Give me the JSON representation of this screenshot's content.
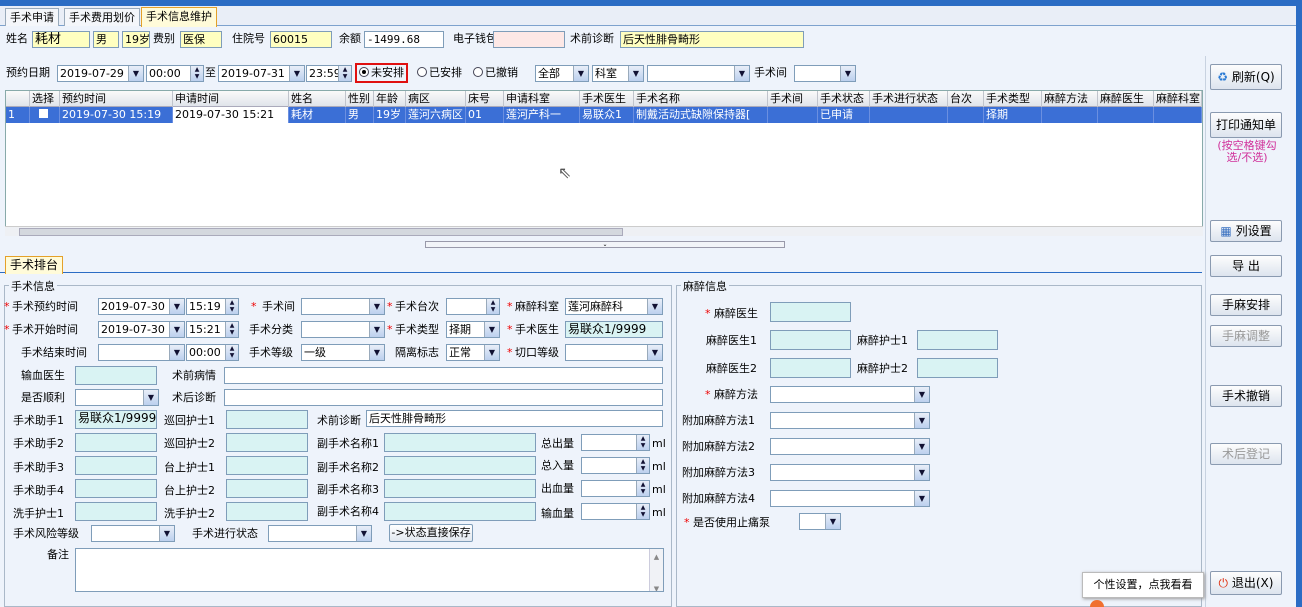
{
  "tabs": [
    "手术申请",
    "手术费用划价",
    "手术信息维护"
  ],
  "patient": {
    "name_label": "姓名",
    "name": "耗材",
    "sex": "男",
    "age": "19岁",
    "fee_label": "费别",
    "fee": "医保",
    "inpatient_label": "住院号",
    "inpatient": "60015",
    "balance_label": "余额",
    "balance": "-1499.68",
    "wallet_label": "电子钱包",
    "wallet": "",
    "diag_label": "术前诊断",
    "diag": "后天性腓骨畸形"
  },
  "filter": {
    "date_label": "预约日期",
    "from_date": "2019-07-29",
    "from_time": "00:00",
    "to_label": "至",
    "to_date": "2019-07-31",
    "to_time": "23:59",
    "r1": "未安排",
    "r2": "已安排",
    "r3": "已撤销",
    "scope": "全部",
    "dept": "科室",
    "dept_val": "",
    "room_label": "手术间",
    "room": ""
  },
  "grid": {
    "headers": [
      "选择",
      "预约时间",
      "申请时间",
      "姓名",
      "性别",
      "年龄",
      "病区",
      "床号",
      "申请科室",
      "手术医生",
      "手术名称",
      "手术间",
      "手术状态",
      "手术进行状态",
      "台次",
      "手术类型",
      "麻醉方法",
      "麻醉医生",
      "麻醉科室"
    ],
    "row": [
      "1",
      "",
      "2019-07-30 15:19",
      "2019-07-30 15:21",
      "耗材",
      "男",
      "19岁",
      "莲河六病区",
      "01",
      "莲河产科一",
      "易联众1",
      "制戴活动式缺隙保持器[",
      "",
      "已申请",
      "",
      "",
      "择期",
      "",
      "",
      ""
    ]
  },
  "section_tab": "手术排台",
  "surg": {
    "title": "手术信息",
    "appt_label": "手术预约时间",
    "appt_date": "2019-07-30",
    "appt_time": "15:19",
    "room_label": "手术间",
    "room": "",
    "table_label": "手术台次",
    "table": "",
    "anes_dept_label": "麻醉科室",
    "anes_dept": "莲河麻醉科",
    "start_label": "手术开始时间",
    "start_date": "2019-07-30",
    "start_time": "15:21",
    "class_label": "手术分类",
    "class": "",
    "type_label": "手术类型",
    "type": "择期",
    "doctor_label": "手术医生",
    "doctor": "易联众1/9999",
    "end_label": "手术结束时间",
    "end_date": "",
    "end_time": "00:00",
    "level_label": "手术等级",
    "level": "一级",
    "iso_label": "隔离标志",
    "iso": "正常",
    "incision_label": "切口等级",
    "incision": "",
    "blood_doc_label": "输血医生",
    "pre_cond_label": "术前病情",
    "smooth_label": "是否顺利",
    "post_diag_label": "术后诊断",
    "asst1_label": "手术助手1",
    "asst1": "易联众1/9999",
    "tour1_label": "巡回护士1",
    "pre_diag_label": "术前诊断",
    "pre_diag": "后天性腓骨畸形",
    "asst2_label": "手术助手2",
    "tour2_label": "巡回护士2",
    "sub1_label": "副手术名称1",
    "out_label": "总出量",
    "asst3_label": "手术助手3",
    "stage1_label": "台上护士1",
    "sub2_label": "副手术名称2",
    "in_label": "总入量",
    "asst4_label": "手术助手4",
    "stage2_label": "台上护士2",
    "sub3_label": "副手术名称3",
    "bleed_label": "出血量",
    "wash_label": "洗手护士1",
    "wash2_label": "洗手护士2",
    "sub4_label": "副手术名称4",
    "trans_label": "输血量",
    "ml": "ml",
    "risk_label": "手术风险等级",
    "status_label": "手术进行状态",
    "save_btn": "->状态直接保存",
    "remark_label": "备注"
  },
  "anes": {
    "title": "麻醉信息",
    "doc_label": "麻醉医生",
    "doc1_label": "麻醉医生1",
    "nurse1_label": "麻醉护士1",
    "doc2_label": "麻醉医生2",
    "nurse2_label": "麻醉护士2",
    "method_label": "麻醉方法",
    "add1": "附加麻醉方法1",
    "add2": "附加麻醉方法2",
    "add3": "附加麻醉方法3",
    "add4": "附加麻醉方法4",
    "pump_label": "是否使用止痛泵"
  },
  "buttons": {
    "refresh": "刷新(Q)",
    "print": "打印通知单",
    "hint": "(按空格键勾选/不选)",
    "cols": "列设置",
    "export": "导 出",
    "arrange": "手麻安排",
    "adjust": "手麻调整",
    "cancel": "手术撤销",
    "postreg": "术后登记",
    "exit": "退出(X)"
  },
  "tooltip": "个性设置，点我看看"
}
